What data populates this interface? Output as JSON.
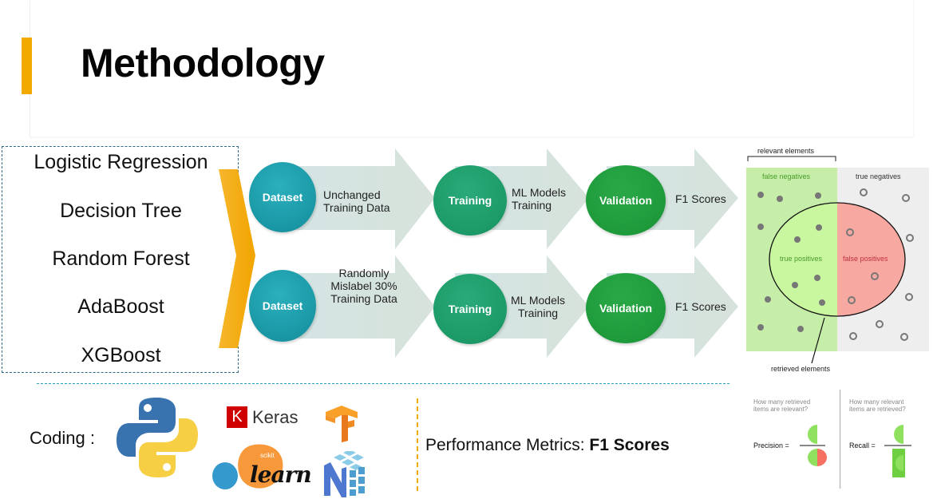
{
  "slide": {
    "title": "Methodology",
    "accent_color": "#f2a900"
  },
  "models": [
    "Logistic Regression",
    "Decision Tree",
    "Random Forest",
    "AdaBoost",
    "XGBoost"
  ],
  "pipelines": [
    {
      "dataset_label": "Dataset",
      "dataset_desc": [
        "Unchanged",
        "Training Data"
      ],
      "training_label": "Training",
      "training_desc": [
        "ML Models",
        "Training"
      ],
      "validation_label": "Validation",
      "validation_desc": "F1 Scores"
    },
    {
      "dataset_label": "Dataset",
      "dataset_desc": [
        "Randomly",
        "Mislabel 30%",
        "Training Data"
      ],
      "training_label": "Training",
      "training_desc": [
        "ML Models",
        "Training"
      ],
      "validation_label": "Validation",
      "validation_desc": "F1 Scores"
    }
  ],
  "venn": {
    "relevant_label": "relevant elements",
    "false_negatives": "false negatives",
    "true_negatives": "true negatives",
    "true_positives": "true positives",
    "false_positives": "false positives",
    "retrieved_label": "retrieved elements",
    "colors": {
      "relevant_bg": "#c6eea8",
      "irrelevant_bg": "#eeeeee",
      "tp": "#c9f5a0",
      "fp": "#f7a8a0",
      "tp_text": "#4a9a2a",
      "fp_text": "#c0303a"
    }
  },
  "coding": {
    "label": "Coding :",
    "tools": [
      {
        "name": "Python",
        "icon": "python-logo"
      },
      {
        "name": "Keras",
        "icon": "keras-logo",
        "badge": "K"
      },
      {
        "name": "TensorFlow",
        "icon": "tensorflow-logo"
      },
      {
        "name": "scikit-learn",
        "icon": "sklearn-logo",
        "small": "scikit",
        "big": "learn"
      },
      {
        "name": "NumPy",
        "icon": "numpy-logo"
      }
    ]
  },
  "performance": {
    "prefix": "Performance Metrics: ",
    "metric": "F1 Scores"
  },
  "precision_recall": {
    "precision_question": [
      "How many retrieved",
      "items are relevant?"
    ],
    "recall_question": [
      "How many relevant",
      "items are retrieved?"
    ],
    "precision_label": "Precision =",
    "recall_label": "Recall ="
  }
}
